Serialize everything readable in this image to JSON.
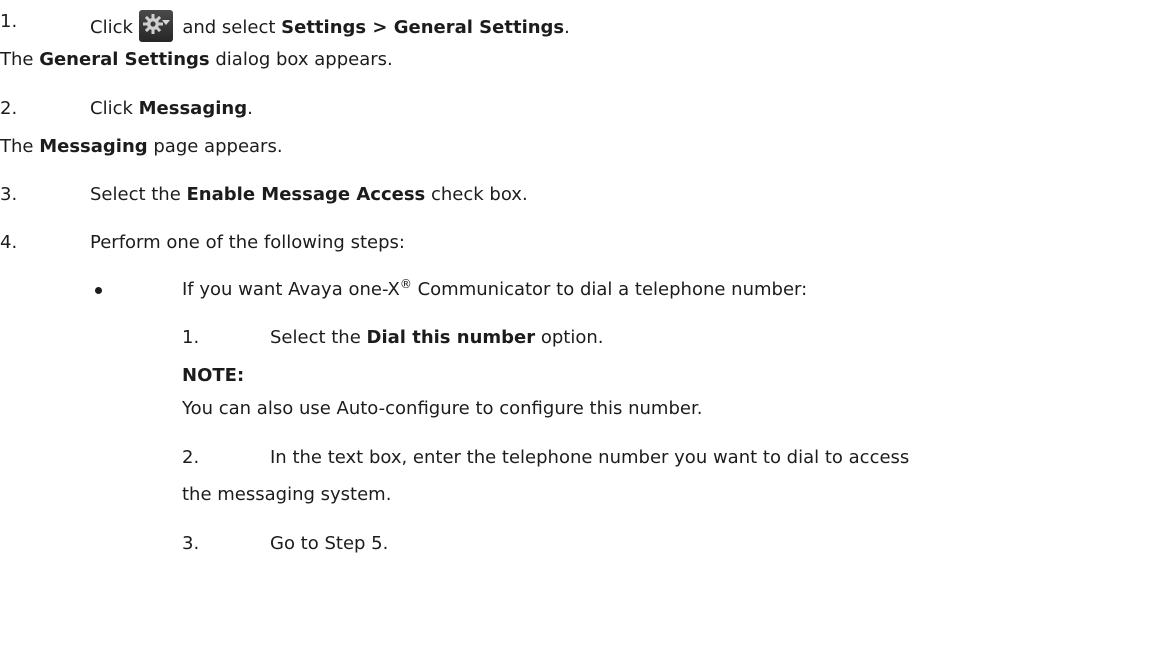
{
  "steps": {
    "s1": {
      "num": "1.",
      "pre": "Click ",
      "mid": " and select ",
      "bold": "Settings > General Settings",
      "post": "."
    },
    "r1": {
      "pre": "The ",
      "bold": "General Settings",
      "post": " dialog box appears."
    },
    "s2": {
      "num": "2.",
      "pre": "Click ",
      "bold": "Messaging",
      "post": "."
    },
    "r2": {
      "pre": "The ",
      "bold": "Messaging",
      "post": " page appears."
    },
    "s3": {
      "num": "3.",
      "pre": "Select the ",
      "bold": "Enable Message Access",
      "post": " check box."
    },
    "s4": {
      "num": "4.",
      "text": "Perform one of the following steps:"
    }
  },
  "bullet": {
    "pre": "If you want Avaya one-X",
    "reg": "®",
    "post": " Communicator to dial a telephone number:"
  },
  "sub": {
    "a": {
      "num": "1.",
      "pre": "Select the ",
      "bold": "Dial this number",
      "post": " option."
    },
    "note_label": "NOTE:",
    "note_text": "You can also use Auto-configure to configure this number.",
    "b": {
      "num": "2.",
      "text": "In the text box, enter the telephone number you want to dial to access",
      "cont": "the messaging system."
    },
    "c": {
      "num": "3.",
      "text": "Go to Step 5."
    }
  },
  "icons": {
    "settings_button": "gear-dropdown-icon"
  }
}
